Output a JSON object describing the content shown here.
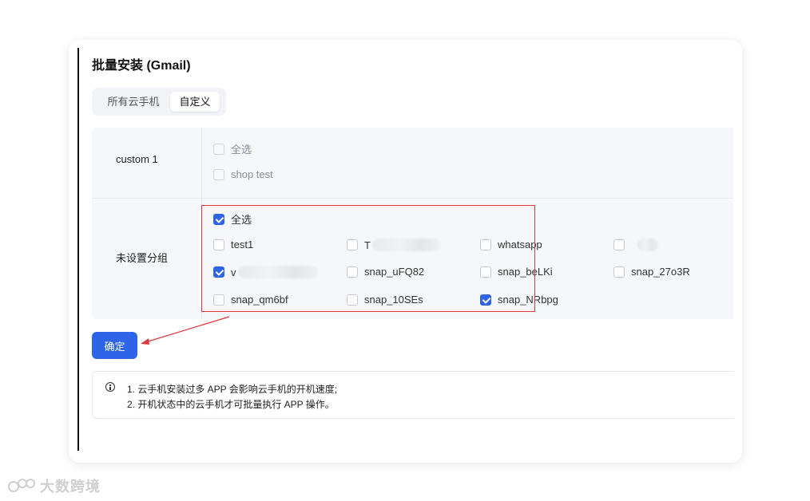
{
  "dialog": {
    "title": "批量安装 (Gmail)"
  },
  "tabs": [
    {
      "label": "所有云手机",
      "active": false
    },
    {
      "label": "自定义",
      "active": true
    }
  ],
  "groups": {
    "custom1": {
      "name": "custom 1",
      "select_all": {
        "label": "全选",
        "checked": false,
        "disabled": true
      },
      "items": [
        {
          "label": "shop test",
          "checked": false,
          "disabled": true
        }
      ]
    },
    "ungrouped": {
      "name": "未设置分组",
      "select_all": {
        "label": "全选",
        "checked": true
      },
      "items": [
        {
          "label": "test1",
          "checked": false
        },
        {
          "label": "T",
          "checked": false,
          "partially_obscured": true
        },
        {
          "label": "whatsapp",
          "checked": false
        },
        {
          "label": "",
          "checked": false,
          "partially_obscured": true
        },
        {
          "label": "v",
          "checked": true,
          "partially_obscured": true
        },
        {
          "label": "snap_uFQ82",
          "checked": false
        },
        {
          "label": "snap_beLKi",
          "checked": false
        },
        {
          "label": "snap_27o3R",
          "checked": false
        },
        {
          "label": "snap_qm6bf",
          "checked": false
        },
        {
          "label": "snap_10SEs",
          "checked": false
        },
        {
          "label": "snap_NRbpg",
          "checked": true
        }
      ]
    }
  },
  "confirm_button": {
    "label": "确定"
  },
  "notice": {
    "icon": "info-icon",
    "lines": [
      "1. 云手机安装过多 APP 会影响云手机的开机速度;",
      "2. 开机状态中的云手机才可批量执行 APP 操作。"
    ]
  },
  "watermark": {
    "text": "大数跨境"
  },
  "colors": {
    "accent": "#2d64e8",
    "annotation": "#e0383e"
  }
}
